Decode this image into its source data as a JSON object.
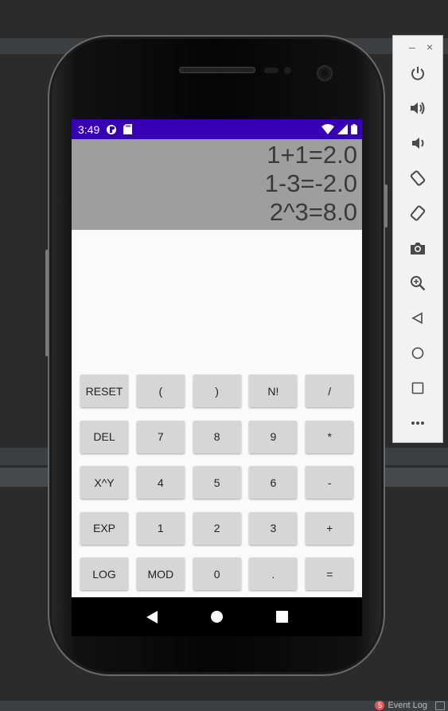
{
  "ide": {
    "event_log_count": "5",
    "event_log_label": "Event Log"
  },
  "phone": {
    "status_bar": {
      "time": "3:49",
      "color": "#3700b3"
    },
    "display": {
      "lines": [
        "1+1=2.0",
        "1-3=-2.0",
        "2^3=8.0"
      ]
    },
    "keypad": {
      "keys": [
        "RESET",
        "(",
        ")",
        "N!",
        "/",
        "DEL",
        "7",
        "8",
        "9",
        "*",
        "X^Y",
        "4",
        "5",
        "6",
        "-",
        "EXP",
        "1",
        "2",
        "3",
        "+",
        "LOG",
        "MOD",
        "0",
        ".",
        "="
      ]
    },
    "nav": {
      "icons": [
        "back-icon",
        "home-icon",
        "recents-icon"
      ]
    }
  },
  "emulator_toolbar": {
    "window_controls": [
      "–",
      "×"
    ],
    "tools": [
      "power-icon",
      "volume-up-icon",
      "volume-down-icon",
      "rotate-left-icon",
      "rotate-right-icon",
      "camera-icon",
      "zoom-icon",
      "back-icon",
      "home-icon",
      "overview-icon",
      "more-icon"
    ]
  }
}
